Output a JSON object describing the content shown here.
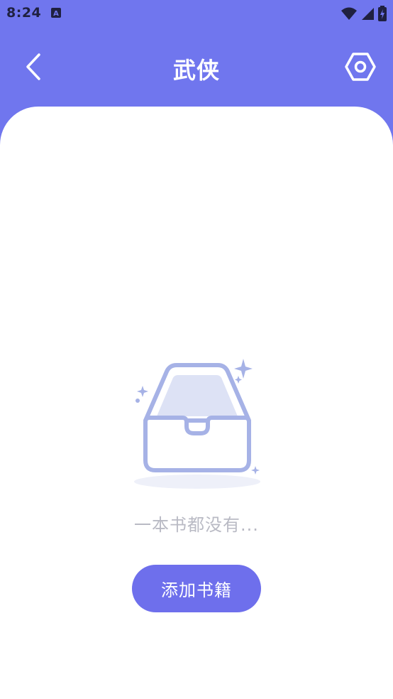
{
  "status_bar": {
    "time": "8:24",
    "app_icon_letter": "A",
    "icons": [
      "wifi-icon",
      "signal-icon",
      "battery-icon"
    ]
  },
  "header": {
    "title": "武侠",
    "back_icon": "chevron-left-icon",
    "settings_icon": "settings-hexagon-icon"
  },
  "empty_state": {
    "icon": "empty-box-icon",
    "message": "一本书都没有...",
    "add_button_label": "添加书籍"
  },
  "colors": {
    "primary": "#7076ee",
    "button": "#6e6fec",
    "illustration_stroke": "#a6b2e6",
    "illustration_fill": "#dde2f5",
    "empty_text": "#b9bac4"
  }
}
